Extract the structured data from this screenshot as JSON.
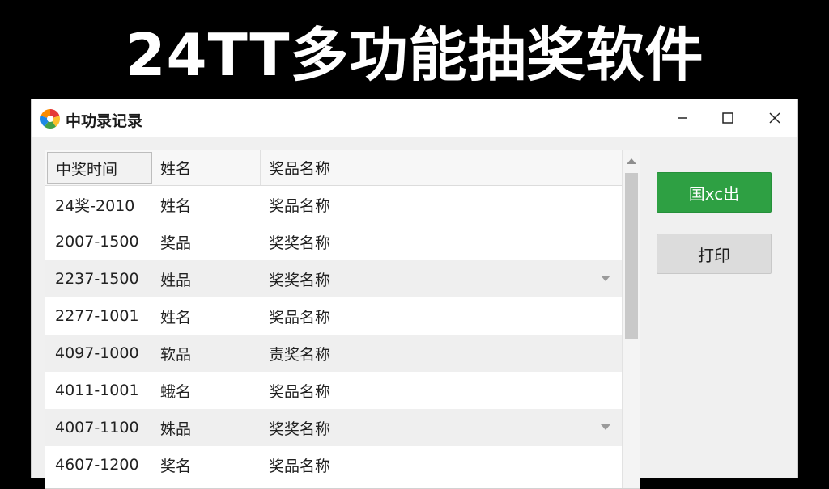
{
  "banner": {
    "title": "24TT多功能抽奖软件"
  },
  "window": {
    "title": "中功录记录",
    "logo_icon": "colorful-pinwheel-logo",
    "controls": {
      "minimize": "minimize-icon",
      "maximize": "maximize-icon",
      "close": "close-icon"
    }
  },
  "table": {
    "columns": [
      "中奖时间",
      "姓名",
      "奖品名称"
    ],
    "rows": [
      {
        "time": "24奖-2010",
        "name": "姓名",
        "prize": "奖品名称",
        "shaded": false,
        "caret": false
      },
      {
        "time": "2007-1500",
        "name": "奖品",
        "prize": "奖奖名称",
        "shaded": false,
        "caret": false
      },
      {
        "time": "2237-1500",
        "name": "姓品",
        "prize": "奖奖名称",
        "shaded": true,
        "caret": true
      },
      {
        "time": "2277-1001",
        "name": "姓名",
        "prize": "奖品名称",
        "shaded": false,
        "caret": false
      },
      {
        "time": "4097-1000",
        "name": "软品",
        "prize": "责奖名称",
        "shaded": true,
        "caret": false
      },
      {
        "time": "4011-1001",
        "name": "蛾名",
        "prize": "奖品名称",
        "shaded": false,
        "caret": false
      },
      {
        "time": "4007-1100",
        "name": "姝品",
        "prize": "奖奖名称",
        "shaded": true,
        "caret": true
      },
      {
        "time": "4607-1200",
        "name": "奖名",
        "prize": "奖品名称",
        "shaded": false,
        "caret": false
      }
    ]
  },
  "actions": {
    "export_label": "国xc出",
    "print_label": "打印"
  },
  "colors": {
    "export_button": "#2ea043",
    "print_button": "#dcdcdc",
    "row_shade": "#efefef",
    "banner_bg": "#000000",
    "banner_text": "#ffffff"
  }
}
